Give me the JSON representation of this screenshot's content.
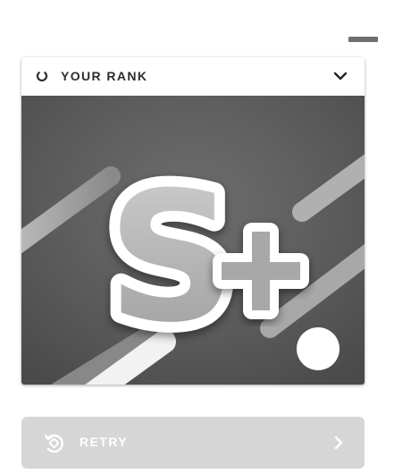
{
  "rank_panel": {
    "title": "YOUR RANK",
    "grade": "S+",
    "icons": {
      "status": "loading-ring-icon",
      "toggle": "chevron-down-icon"
    }
  },
  "retry_button": {
    "label": "RETRY",
    "icons": {
      "action": "retry-icon",
      "forward": "chevron-right-icon"
    }
  },
  "colors": {
    "card_background": "#ffffff",
    "rank_background": "#5a5a5a",
    "retry_background": "#d6d6d6",
    "retry_text": "#ffffff",
    "header_text": "#2d2d2d"
  }
}
